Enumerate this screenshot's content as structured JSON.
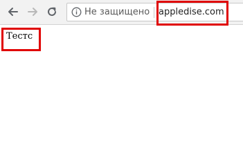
{
  "browser": {
    "back_icon": "arrow-left-icon",
    "forward_icon": "arrow-right-icon",
    "reload_icon": "reload-icon",
    "info_icon": "info-icon",
    "omnibox": {
      "security_label": "Не защищено",
      "url": "appledise.com"
    }
  },
  "page": {
    "text": "Тестс"
  },
  "colors": {
    "highlight": "#e00000",
    "toolbar": "#f2f2f2"
  }
}
